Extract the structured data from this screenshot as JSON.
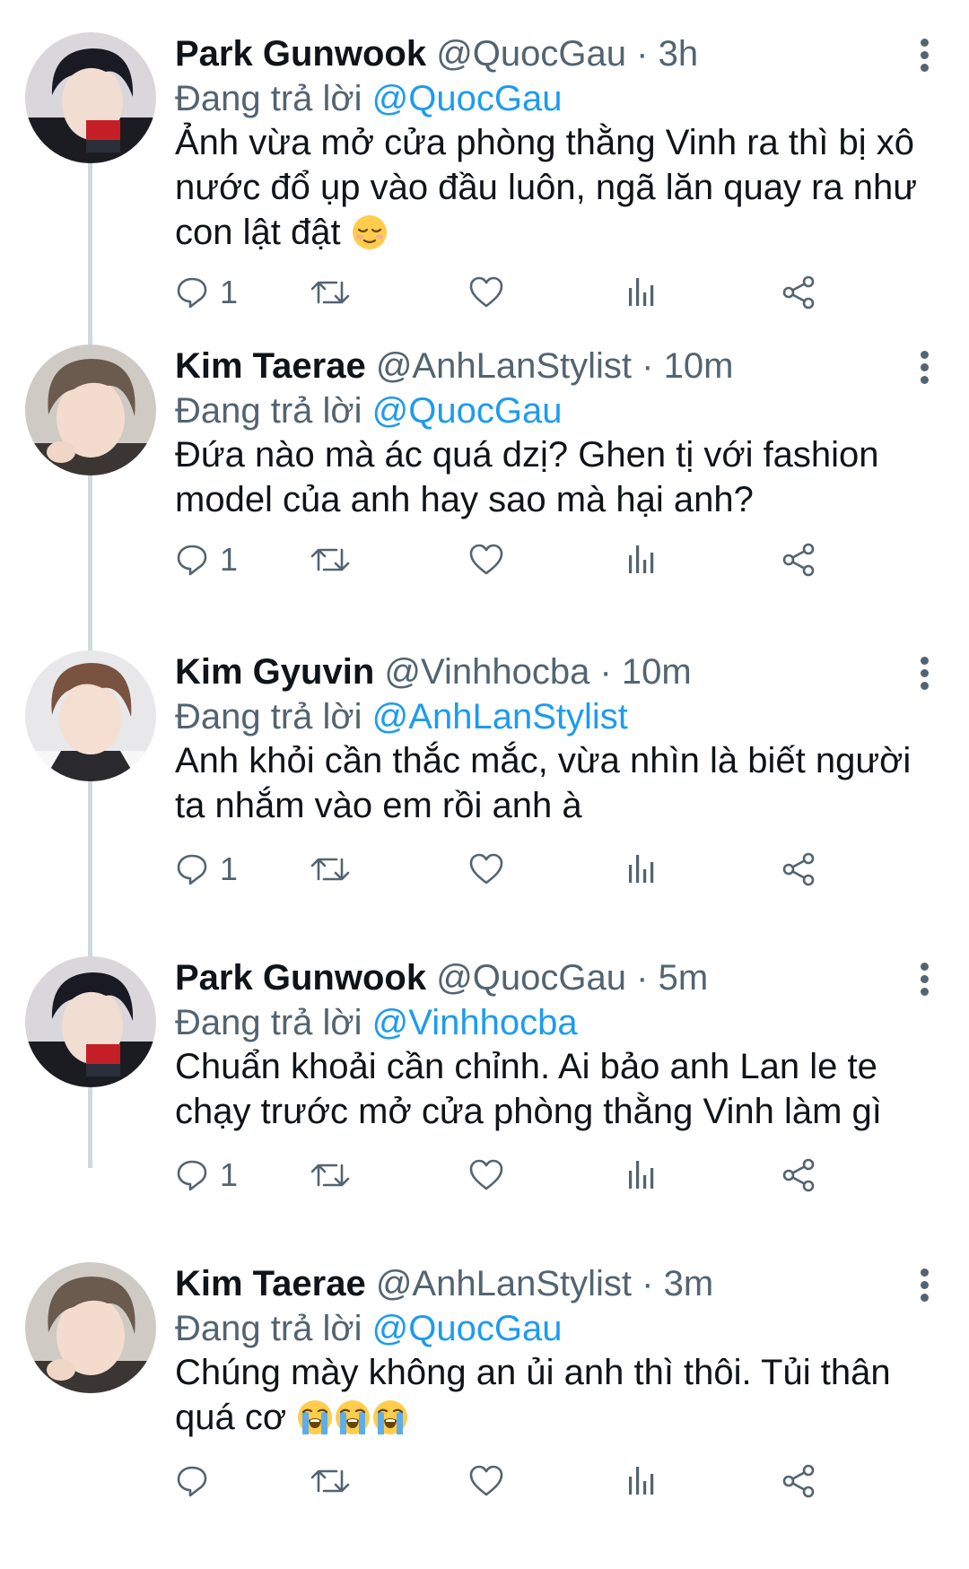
{
  "tweets": [
    {
      "name": "Park Gunwook",
      "handle": "@QuocGau",
      "time": "3h",
      "replying_label": "Đang trả lời",
      "replying_to": "@QuocGau",
      "text": "Ảnh vừa mở cửa phòng thằng Vinh ra thì bị xô nước đổ ụp vào đầu luôn, ngã lăn quay ra như con lật đật",
      "emojis": [
        "relieved-face"
      ],
      "reply_count": "1"
    },
    {
      "name": "Kim Taerae",
      "handle": "@AnhLanStylist",
      "time": "10m",
      "replying_label": "Đang trả lời",
      "replying_to": "@QuocGau",
      "text": "Đứa nào mà ác quá dzị? Ghen tị với fashion model của anh hay sao mà hại anh?",
      "emojis": [],
      "reply_count": "1"
    },
    {
      "name": "Kim Gyuvin",
      "handle": "@Vinhhocba",
      "time": "10m",
      "replying_label": "Đang trả lời",
      "replying_to": "@AnhLanStylist",
      "text": "Anh khỏi cần thắc mắc, vừa nhìn là biết người ta nhắm vào em rồi anh à",
      "emojis": [],
      "reply_count": "1"
    },
    {
      "name": "Park Gunwook",
      "handle": "@QuocGau",
      "time": "5m",
      "replying_label": "Đang trả lời",
      "replying_to": "@Vinhhocba",
      "text": "Chuẩn khoải cần chỉnh. Ai bảo anh Lan le te chạy trước mở cửa phòng thằng Vinh làm gì",
      "emojis": [],
      "reply_count": "1"
    },
    {
      "name": "Kim Taerae",
      "handle": "@AnhLanStylist",
      "time": "3m",
      "replying_label": "Đang trả lời",
      "replying_to": "@QuocGau",
      "text": "Chúng mày không an ủi anh thì thôi. Tủi thân quá cơ",
      "emojis": [
        "loudly-crying-face",
        "loudly-crying-face",
        "loudly-crying-face"
      ],
      "reply_count": ""
    }
  ],
  "separator": "·",
  "icons": {
    "reply": "reply-icon",
    "retweet": "retweet-icon",
    "like": "heart-icon",
    "views": "analytics-icon",
    "share": "share-icon",
    "more": "more-vertical-icon"
  },
  "colors": {
    "text": "#0f1419",
    "secondary": "#536471",
    "link": "#1d9bf0",
    "thread_line": "#cfd9de",
    "background": "#ffffff"
  }
}
